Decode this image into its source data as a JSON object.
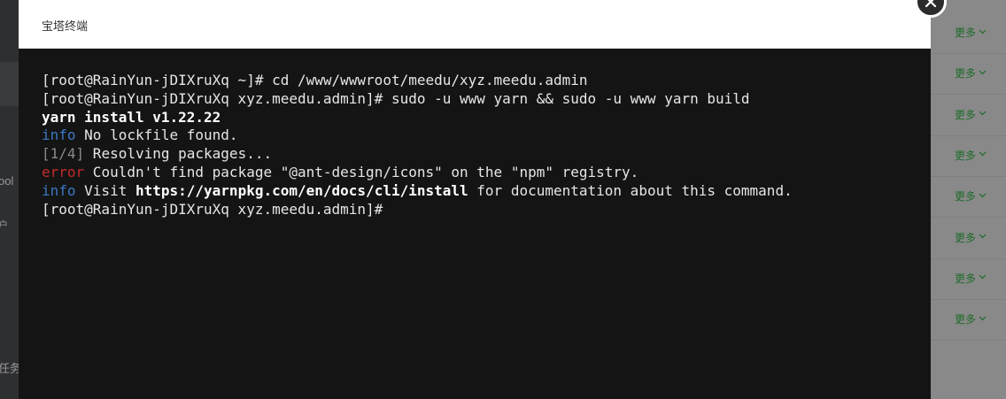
{
  "background": {
    "sidebar_fragments": [
      "ool",
      "户",
      "任务"
    ],
    "more_label": "更多",
    "more_rows": 8
  },
  "modal": {
    "title": "宝塔终端"
  },
  "terminal": {
    "lines": [
      {
        "parts": [
          {
            "text": "[root@RainYun-jDIXruXq ~]# cd /www/wwwroot/meedu/xyz.meedu.admin",
            "style": "normal"
          }
        ]
      },
      {
        "parts": [
          {
            "text": "[root@RainYun-jDIXruXq xyz.meedu.admin]# sudo -u www yarn && sudo -u www yarn build",
            "style": "normal"
          }
        ]
      },
      {
        "parts": [
          {
            "text": "yarn install v1.22.22",
            "style": "bold"
          }
        ]
      },
      {
        "parts": [
          {
            "text": "info",
            "style": "info"
          },
          {
            "text": " No lockfile found.",
            "style": "normal"
          }
        ]
      },
      {
        "parts": [
          {
            "text": "[1/4]",
            "style": "dim"
          },
          {
            "text": " Resolving packages...",
            "style": "normal"
          }
        ]
      },
      {
        "parts": [
          {
            "text": "error",
            "style": "error"
          },
          {
            "text": " Couldn't find package \"@ant-design/icons\" on the \"npm\" registry.",
            "style": "normal"
          }
        ]
      },
      {
        "parts": [
          {
            "text": "info",
            "style": "info"
          },
          {
            "text": " Visit ",
            "style": "normal"
          },
          {
            "text": "https://yarnpkg.com/en/docs/cli/install",
            "style": "bold"
          },
          {
            "text": " for documentation about this command.",
            "style": "normal"
          }
        ]
      },
      {
        "parts": [
          {
            "text": "[root@RainYun-jDIXruXq xyz.meedu.admin]#",
            "style": "normal"
          }
        ]
      }
    ]
  },
  "colors": {
    "terminal_bg": "#141414",
    "info": "#3b78c4",
    "error": "#c42b2b",
    "more_link": "#1e6b2a"
  }
}
